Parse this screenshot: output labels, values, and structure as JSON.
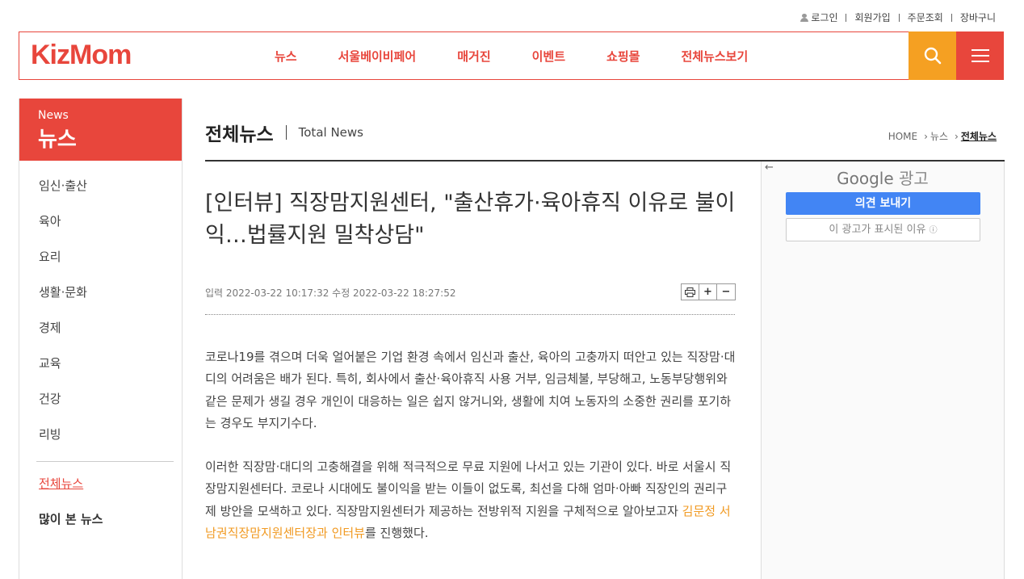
{
  "util": {
    "login": "로그인",
    "signup": "회원가입",
    "orders": "주문조회",
    "cart": "장바구니"
  },
  "logo": "KizMom",
  "gnb": [
    "뉴스",
    "서울베이비페어",
    "매거진",
    "이벤트",
    "쇼핑몰",
    "전체뉴스보기"
  ],
  "side": {
    "en": "News",
    "ko": "뉴스",
    "items": [
      "임신·출산",
      "육아",
      "요리",
      "생활·문화",
      "경제",
      "교육",
      "건강",
      "리빙"
    ],
    "all_news": "전체뉴스",
    "popular": "많이 본 뉴스"
  },
  "page": {
    "title_ko": "전체뉴스",
    "title_en": "Total News"
  },
  "crumb": {
    "home": "HOME",
    "news": "뉴스",
    "current": "전체뉴스"
  },
  "article": {
    "headline": "[인터뷰] 직장맘지원센터, \"출산휴가·육아휴직 이유로 불이익…법률지원 밀착상담\"",
    "meta": "입력 2022-03-22 10:17:32 수정 2022-03-22 18:27:52",
    "p1": "코로나19를 겪으며 더욱 얼어붙은 기업 환경 속에서 임신과 출산, 육아의 고충까지 떠안고 있는 직장맘·대디의 어려움은 배가 된다. 특히, 회사에서 출산·육아휴직 사용 거부, 임금체불, 부당해고, 노동부당행위와 같은 문제가 생길 경우 개인이 대응하는 일은 쉽지 않거니와, 생활에 치여 노동자의 소중한 권리를 포기하는 경우도 부지기수다.",
    "p2_a": "이러한 직장맘·대디의 고충해결을 위해 적극적으로 무료 지원에 나서고 있는 기관이 있다. 바로 서울시 직장맘지원센터다. 코로나 시대에도 불이익을 받는 이들이 없도록, 최선을 다해 엄마·아빠 직장인의 권리구제 방안을 모색하고 있다. 직장맘지원센터가 제공하는 전방위적 지원을 구체적으로 알아보고자 ",
    "p2_hl": "김문정 서남권직장맘지원센터장과 인터뷰",
    "p2_b": "를 진행했다."
  },
  "ad": {
    "google": "Google",
    "label": "광고",
    "feedback": "의견 보내기",
    "why": "이 광고가 표시된 이유"
  }
}
